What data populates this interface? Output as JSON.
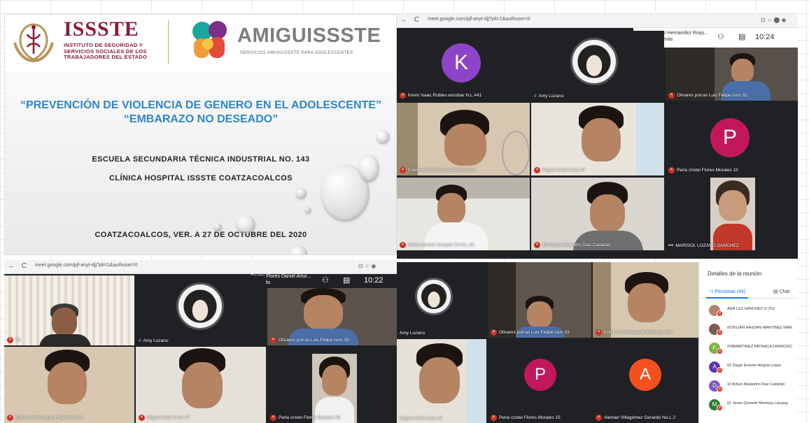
{
  "slide": {
    "issste_name": "ISSSTE",
    "issste_sub": "INSTITUTO DE SEGURIDAD Y SERVICIOS SOCIALES DE LOS TRABAJADORES DEL ESTADO",
    "amigu_name": "AMIGUISSSTE",
    "amigu_sub": "SERVICIOS AMIGUISSSTE PARA ADOLESCENTES",
    "title_line1": "“PREVENCIÓN DE VIOLENCIA DE GENERO EN EL ADOLESCENTE”",
    "title_line2": "“EMBARAZO NO DESEADO”",
    "school": "ESCUELA SECUNDARIA TÉCNICA INDUSTRIAL NO. 143",
    "clinic": "CLÍNICA HOSPITAL ISSSTE COATZACOALCOS",
    "place_date": "COATZACOALCOS, VER. A 27 DE OCTUBRE DEL 2020"
  },
  "meet1": {
    "url": "meet.google.com/pjf-anyt-djj?pli=1&authuser=0",
    "participant_name": "Oscar Hernandez Roqu...",
    "participant_more": "y 33 más",
    "participant_initial": "O",
    "people_count": "34",
    "clock": "10:24",
    "tiles": [
      {
        "name": "Kevin Isaac Robles escobar N.L.#41",
        "initial": "K",
        "color": "#8e44c9"
      },
      {
        "name": "Amy Lozano"
      },
      {
        "name": "Olivares porras Luis Felipe num 33"
      },
      {
        "name": "Edwin Ismith Aquino Martinez N.4"
      },
      {
        "name": "Miguel Uribe Cruz 47"
      },
      {
        "name": "Perla cristel Flores Morales 15",
        "initial": "P",
        "color": "#c2185b"
      },
      {
        "name": "Nevin Gomez Joaquin 1A N.L.16"
      },
      {
        "name": "10 Arturo Alejandro Diaz Castelan"
      },
      {
        "name": "MARISOL LOZANO SANCHEZ"
      }
    ]
  },
  "meet2": {
    "url": "meet.google.com/pjf-anyt-djj?pli=1&authuser=0",
    "participant_name": "Castro Flores Daniel Artur...",
    "participant_more": "y 33 más",
    "people_count": "34",
    "clock": "10:22",
    "tiles": [
      {
        "name": "Tú"
      },
      {
        "name": "Amy Lozano"
      },
      {
        "name": "Olivares porras Luis Felipe num 33"
      },
      {
        "name": "Edwin Ismith Aquino Martinez N.4"
      },
      {
        "name": "Miguel Uribe Cruz 47"
      },
      {
        "name": "Perla cristel Flores Morales 15"
      }
    ]
  },
  "meet3": {
    "tiles": [
      {
        "name": "Amy Lozano"
      },
      {
        "name": "Olivares porras Luis Felipe num 33"
      },
      {
        "name": "Edwin Ismith Aquino Martinez N.4"
      },
      {
        "name": "Miguel Uribe Cruz 47"
      },
      {
        "name": "Perla cristel Flores Morales 15",
        "initial": "P",
        "color": "#c2185b"
      },
      {
        "name": "Alemán Villagómez Gerardo No.L.2",
        "initial": "A",
        "color": "#f4511e"
      }
    ]
  },
  "details": {
    "title": "Detalles de la reunión",
    "tab_people": "Personas (44)",
    "tab_chat": "Chat",
    "people": [
      {
        "name": "ANA LUZ SANCHEZ O (Tú)",
        "initial": "",
        "color": "#b0866a"
      },
      {
        "name": "#27ELIAN HASSAN MARTINEZ MAR",
        "initial": "",
        "color": "#7b5e52"
      },
      {
        "name": "#28MARTINEZ PATRACA FRANCISC",
        "initial": "F",
        "color": "#7cb342"
      },
      {
        "name": "01 Diego Ernesto Alegria Lopez",
        "initial": "A",
        "color": "#5e35b1"
      },
      {
        "name": "10 Arturo Alejandro Diaz Castelan",
        "initial": "D",
        "color": "#7e57c2"
      },
      {
        "name": "01 Jesse Gerardo Montoya Uscang",
        "initial": "M",
        "color": "#2e7d32"
      }
    ]
  }
}
